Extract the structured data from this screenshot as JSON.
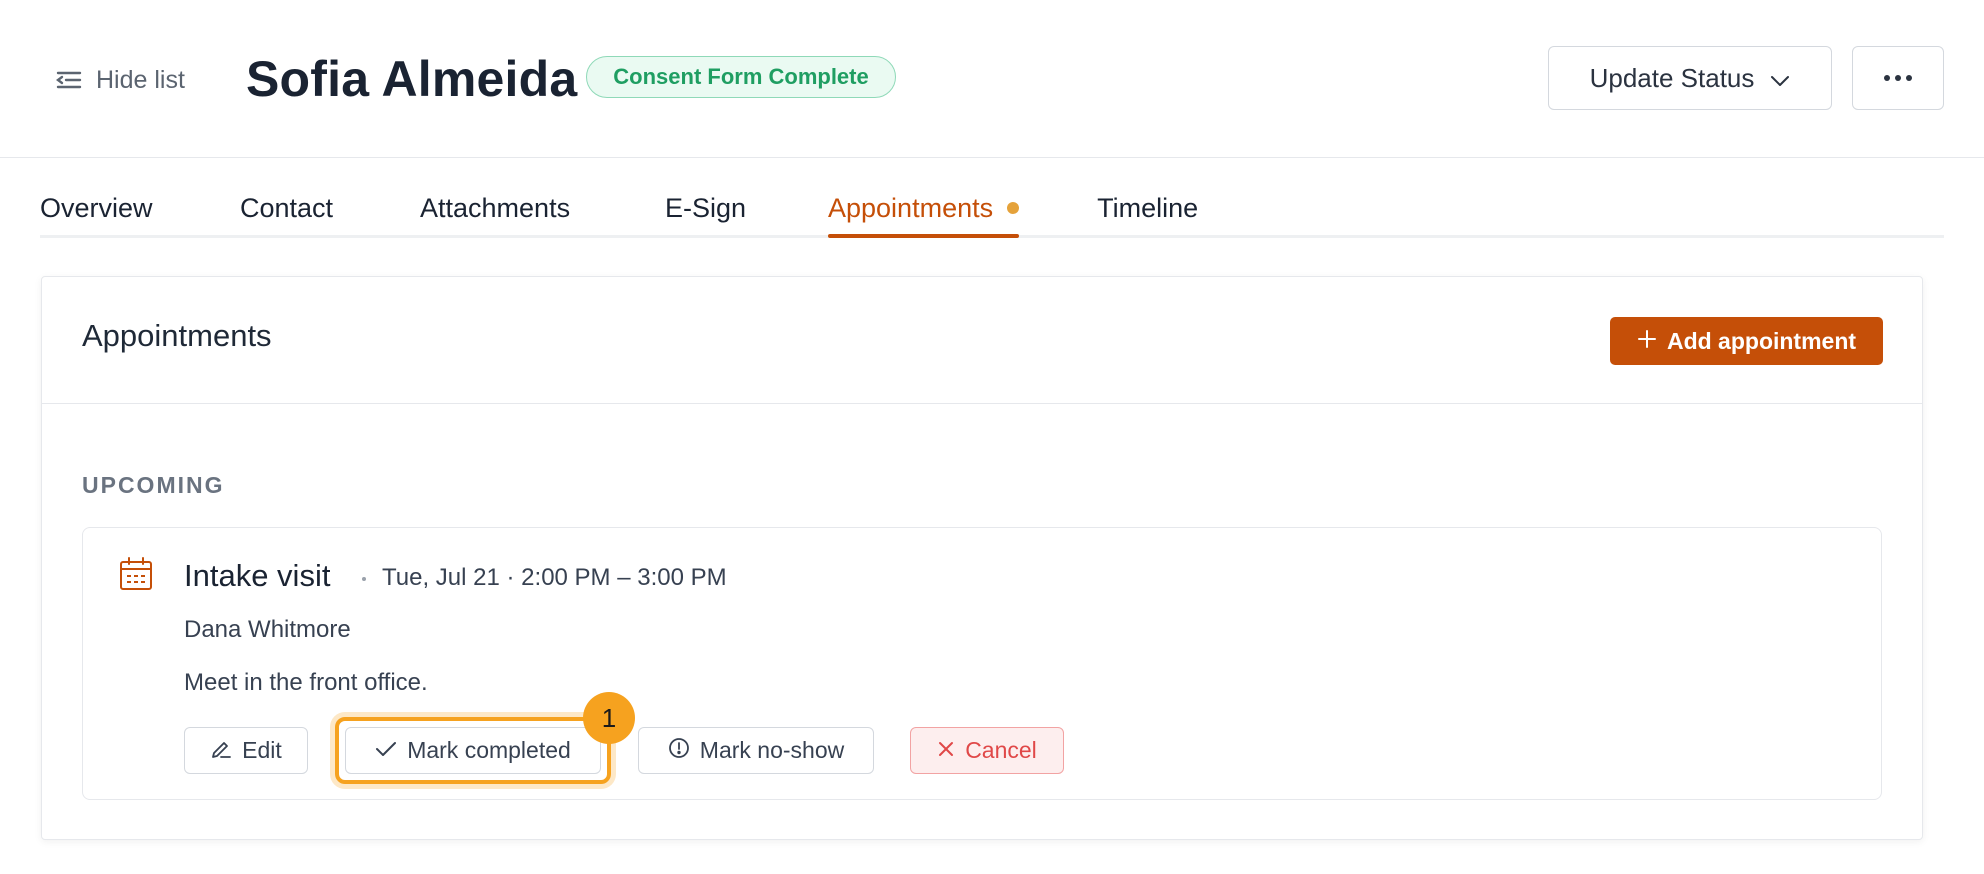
{
  "header": {
    "hide_list_label": "Hide list",
    "client_name": "Sofia Almeida",
    "status_badge": "Consent Form Complete",
    "update_status_label": "Update Status"
  },
  "tabs": [
    {
      "label": "Overview",
      "active": false
    },
    {
      "label": "Contact",
      "active": false
    },
    {
      "label": "Attachments",
      "active": false
    },
    {
      "label": "E-Sign",
      "active": false
    },
    {
      "label": "Appointments",
      "active": true
    },
    {
      "label": "Timeline",
      "active": false
    }
  ],
  "card": {
    "title": "Appointments",
    "add_button_label": "Add appointment",
    "section_label": "UPCOMING"
  },
  "appointment": {
    "title": "Intake visit",
    "time": "Tue, Jul 21 · 2:00 PM – 3:00 PM",
    "attendee": "Dana Whitmore",
    "note": "Meet in the front office.",
    "actions": {
      "edit": "Edit",
      "mark_completed": "Mark completed",
      "mark_no_show": "Mark no-show",
      "cancel": "Cancel"
    }
  },
  "highlight_marker": "1",
  "colors": {
    "accent": "#c54f08",
    "badge_green": "#1f9e62",
    "highlight": "#f6a21f",
    "danger": "#e04848"
  }
}
